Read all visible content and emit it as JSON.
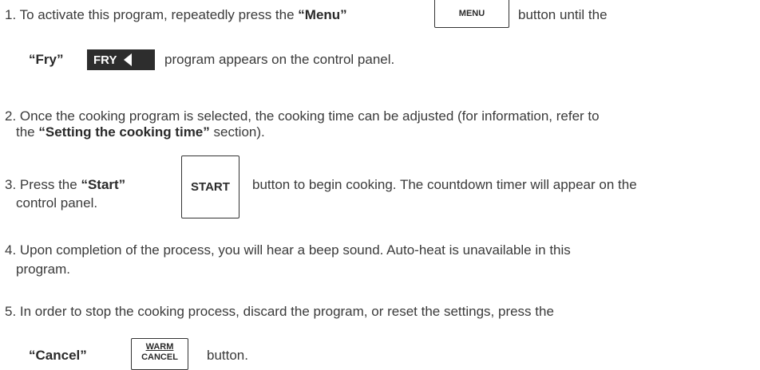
{
  "step1": {
    "text_a": "1. To activate this program, repeatedly press the ",
    "menu_quoted": "“Menu”",
    "menu_key": "MENU",
    "text_b": "button until the",
    "fry_quoted": "“Fry”",
    "fry_key": "FRY",
    "text_c": "program appears on the control panel."
  },
  "step2": {
    "line1": "2. Once the cooking program is selected, the cooking time can be adjusted (for information, refer to",
    "line2_a": "the ",
    "line2_bold": "“Setting the cooking time”",
    "line2_b": " section)."
  },
  "step3": {
    "text_a": "3. Press the ",
    "start_quoted": "“Start”",
    "start_key": "START",
    "text_b": "button to begin cooking. The countdown timer will appear on the",
    "line2": "control panel."
  },
  "step4": {
    "line1": "4. Upon completion of the process, you will hear a beep sound. Auto-heat is unavailable in this",
    "line2": "program."
  },
  "step5": {
    "line1": "5. In order to stop the cooking process, discard the program, or reset the settings, press the",
    "cancel_quoted": "“Cancel”",
    "key_top": "WARM",
    "key_bottom": "CANCEL",
    "text_b": "button."
  }
}
